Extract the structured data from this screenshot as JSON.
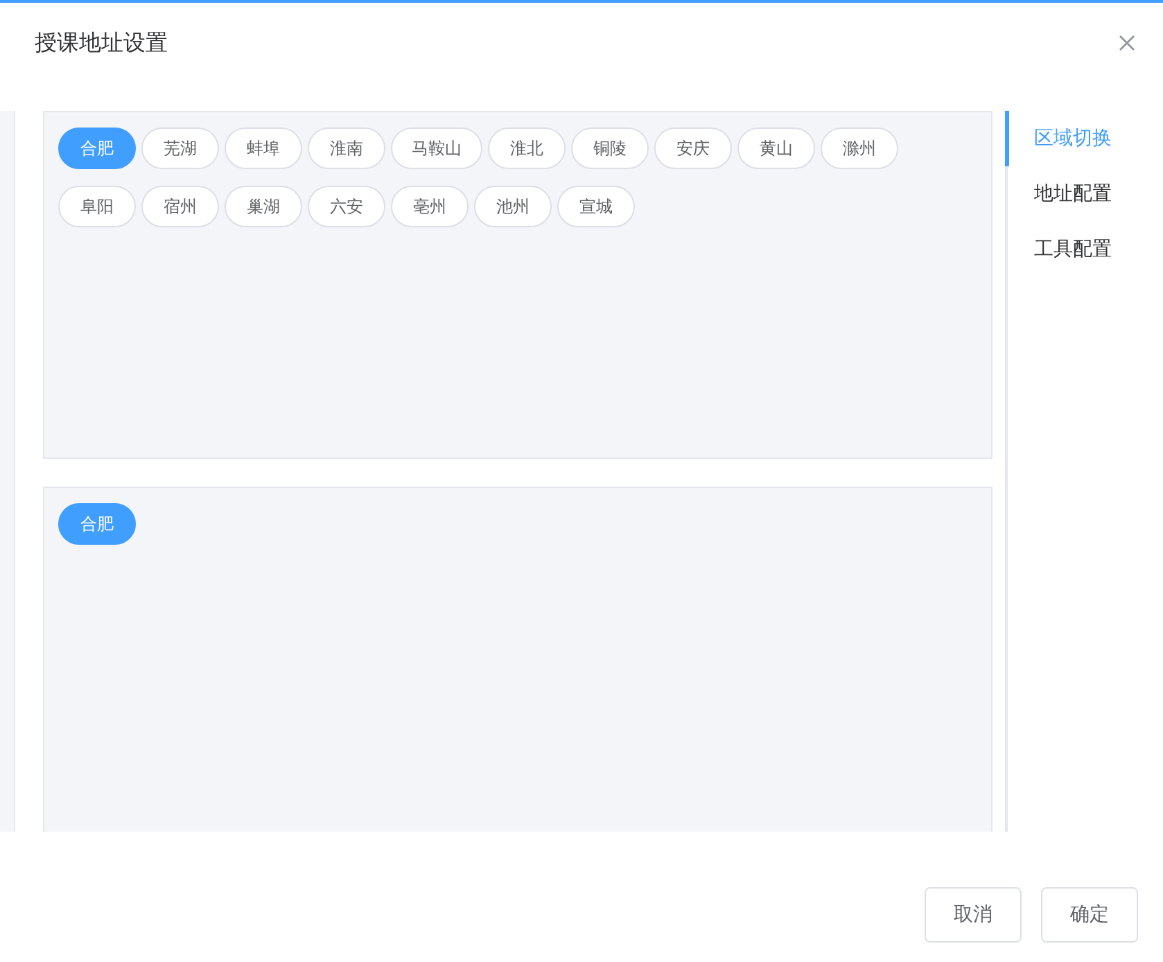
{
  "dialog": {
    "title": "授课地址设置"
  },
  "regions": [
    {
      "label": "合肥",
      "selected": true
    },
    {
      "label": "芜湖",
      "selected": false
    },
    {
      "label": "蚌埠",
      "selected": false
    },
    {
      "label": "淮南",
      "selected": false
    },
    {
      "label": "马鞍山",
      "selected": false
    },
    {
      "label": "淮北",
      "selected": false
    },
    {
      "label": "铜陵",
      "selected": false
    },
    {
      "label": "安庆",
      "selected": false
    },
    {
      "label": "黄山",
      "selected": false
    },
    {
      "label": "滁州",
      "selected": false
    },
    {
      "label": "阜阳",
      "selected": false
    },
    {
      "label": "宿州",
      "selected": false
    },
    {
      "label": "巢湖",
      "selected": false
    },
    {
      "label": "六安",
      "selected": false
    },
    {
      "label": "亳州",
      "selected": false
    },
    {
      "label": "池州",
      "selected": false
    },
    {
      "label": "宣城",
      "selected": false
    }
  ],
  "chosen": [
    {
      "label": "合肥",
      "selected": true
    }
  ],
  "nav": [
    {
      "label": "区域切换",
      "selected": true
    },
    {
      "label": "地址配置",
      "selected": false
    },
    {
      "label": "工具配置",
      "selected": false
    }
  ],
  "buttons": [
    "取消",
    "确定"
  ]
}
